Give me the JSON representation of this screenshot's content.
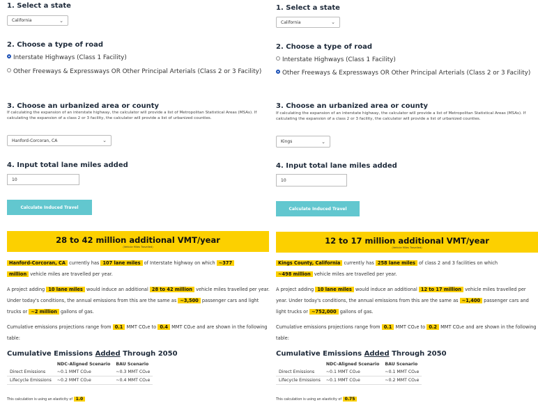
{
  "left": {
    "step1_title": "1. Select a state",
    "state_value": "California",
    "step2_title": "2. Choose a type of road",
    "road_option_1": "Interstate Highways (Class 1 Facility)",
    "road_option_2": "Other Freeways & Expressways OR Other Principal Arterials (Class 2 or 3 Facility)",
    "road_selected": 1,
    "step3_title": "3. Choose an urbanized area or county",
    "step3_help": "If calculating the expansion of an interstate highway, the calculator will provide a list of Metropolitan Statistical Areas (MSAs). If calculating the expansion of a class 2 or 3 facility, the calculator will provide a list of urbanized counties.",
    "area_value": "Hanford-Corcoran, CA",
    "step4_title": "4. Input total lane miles added",
    "lane_miles_input": "10",
    "calc_button": "Calculate Induced Travel",
    "result_big": "28 to 42 million additional VMT/year",
    "result_sub": "(Vehicle Miles Travelled)",
    "p1_area": "Hanford-Corcoran, CA",
    "p1_t1": "currently has",
    "p1_lane": "107 lane miles",
    "p1_t2": "of Interstate highway on which",
    "p1_vmt_a": "~377",
    "p1_vmt_b": "million",
    "p1_t3": "vehicle miles are travelled per year.",
    "p2_t1": "A project adding",
    "p2_lane": "10 lane miles",
    "p2_t2": "would induce an additional",
    "p2_vmt": "28 to 42 million",
    "p2_t3": "vehicle miles travelled per year. Under today's conditions, the annual emissions from this are the same as",
    "p2_cars": "~3,500",
    "p2_t4": "passenger cars and light trucks or",
    "p2_gal": "~2 million",
    "p2_t5": "gallons of gas.",
    "p3_t1": "Cumulative emissions projections range from",
    "p3_v1": "0.1",
    "p3_t2": "MMT CO₂e to",
    "p3_v2": "0.4",
    "p3_t3": "MMT CO₂e and are shown in the following table:",
    "cum_title_a": "Cumulative Emissions ",
    "cum_title_u": "Added",
    "cum_title_b": " Through 2050",
    "col1": "NDC-Aligned Scenario",
    "col2": "BAU Scenario",
    "row1_label": "Direct Emissions",
    "row1_c1": "~0.1 MMT CO₂e",
    "row1_c2": "~0.3 MMT CO₂e",
    "row2_label": "Lifecycle Emissions",
    "row2_c1": "~0.2 MMT CO₂e",
    "row2_c2": "~0.4 MMT CO₂e",
    "note": "This calculation is using an elasticity of",
    "elasticity": "1.0"
  },
  "right": {
    "step1_title": "1. Select a state",
    "state_value": "California",
    "step2_title": "2. Choose a type of road",
    "road_option_1": "Interstate Highways (Class 1 Facility)",
    "road_option_2": "Other Freeways & Expressways OR Other Principal Arterials (Class 2 or 3 Facility)",
    "road_selected": 2,
    "step3_title": "3. Choose an urbanized area or county",
    "step3_help": "If calculating the expansion of an interstate highway, the calculator will provide a list of Metropolitan Statistical Areas (MSAs). If calculating the expansion of a class 2 or 3 facility, the calculator will provide a list of urbanized counties.",
    "area_value": "Kings",
    "step4_title": "4. Input total lane miles added",
    "lane_miles_input": "10",
    "calc_button": "Calculate Induced Travel",
    "result_big": "12 to 17 million additional VMT/year",
    "result_sub": "(Vehicle Miles Travelled)",
    "p1_area": "Kings County, California",
    "p1_t1": "currently has",
    "p1_lane": "258 lane miles",
    "p1_t2": "of class 2 and 3 facilities on which",
    "p1_vmt": "~498 million",
    "p1_t3": "vehicle miles are travelled per year.",
    "p2_t1": "A project adding",
    "p2_lane": "10 lane miles",
    "p2_t2": "would induce an additional",
    "p2_vmt": "12 to 17 million",
    "p2_t3": "vehicle miles travelled per year. Under today's conditions, the annual emissions from this are the same as",
    "p2_cars": "~1,400",
    "p2_t4": "passenger cars and light trucks or",
    "p2_gal": "~752,000",
    "p2_t5": "gallons of gas.",
    "p3_t1": "Cumulative emissions projections range from",
    "p3_v1": "0.1",
    "p3_t2": "MMT CO₂e to",
    "p3_v2": "0.2",
    "p3_t3": "MMT CO₂e and are shown in the following table:",
    "cum_title_a": "Cumulative Emissions ",
    "cum_title_u": "Added",
    "cum_title_b": " Through 2050",
    "col1": "NDC-Aligned Scenario",
    "col2": "BAU Scenario",
    "row1_label": "Direct Emissions",
    "row1_c1": "~0.1 MMT CO₂e",
    "row1_c2": "~0.1 MMT CO₂e",
    "row2_label": "Lifecycle Emissions",
    "row2_c1": "~0.1 MMT CO₂e",
    "row2_c2": "~0.2 MMT CO₂e",
    "note": "This calculation is using an elasticity of",
    "elasticity": "0.75"
  },
  "colors": {
    "highlight": "#fcd000",
    "button": "#62c7cf",
    "radio_selected": "#1a4fb5",
    "heading": "#1e2a3a"
  },
  "icons": {
    "dropdown": "chevron-down-icon",
    "radio": "radio-icon"
  }
}
